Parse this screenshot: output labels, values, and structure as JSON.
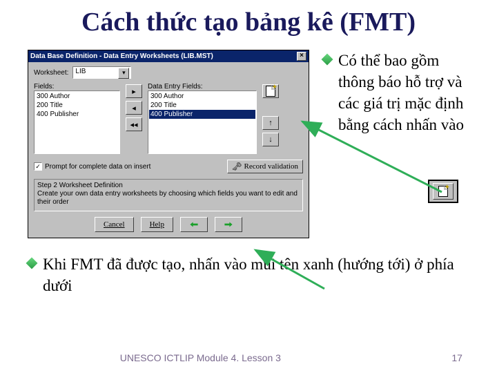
{
  "title": "Cách thức tạo bảng kê (FMT)",
  "dialog": {
    "title": "Data Base Definition - Data Entry Worksheets (LIB.MST)",
    "worksheet_label": "Worksheet:",
    "worksheet_value": "LIB",
    "fields_label": "Fields:",
    "data_entry_label": "Data Entry Fields:",
    "fields": [
      "300 Author",
      "200 Title",
      "400 Publisher"
    ],
    "entry_fields": [
      "300 Author",
      "200 Title",
      "400 Publisher"
    ],
    "selected_entry": "400 Publisher",
    "prompt_checkbox": "Prompt for complete data on insert",
    "record_validation": "Record validation",
    "step_header": "Step 2  Worksheet Definition",
    "step_text": "Create your own data entry worksheets by choosing which fields you want to edit and their order",
    "buttons": {
      "cancel": "Cancel",
      "help": "Help"
    }
  },
  "bullets": {
    "b1": "Có thể bao gồm thông báo hỗ trợ và các giá trị mặc định bằng cách nhấn vào",
    "b2": "Khi FMT đã được tạo, nhấn vào mũi tên xanh (hướng tới) ở phía dưới"
  },
  "footer": {
    "text": "UNESCO ICTLIP Module 4.  Lesson 3",
    "page": "17"
  }
}
